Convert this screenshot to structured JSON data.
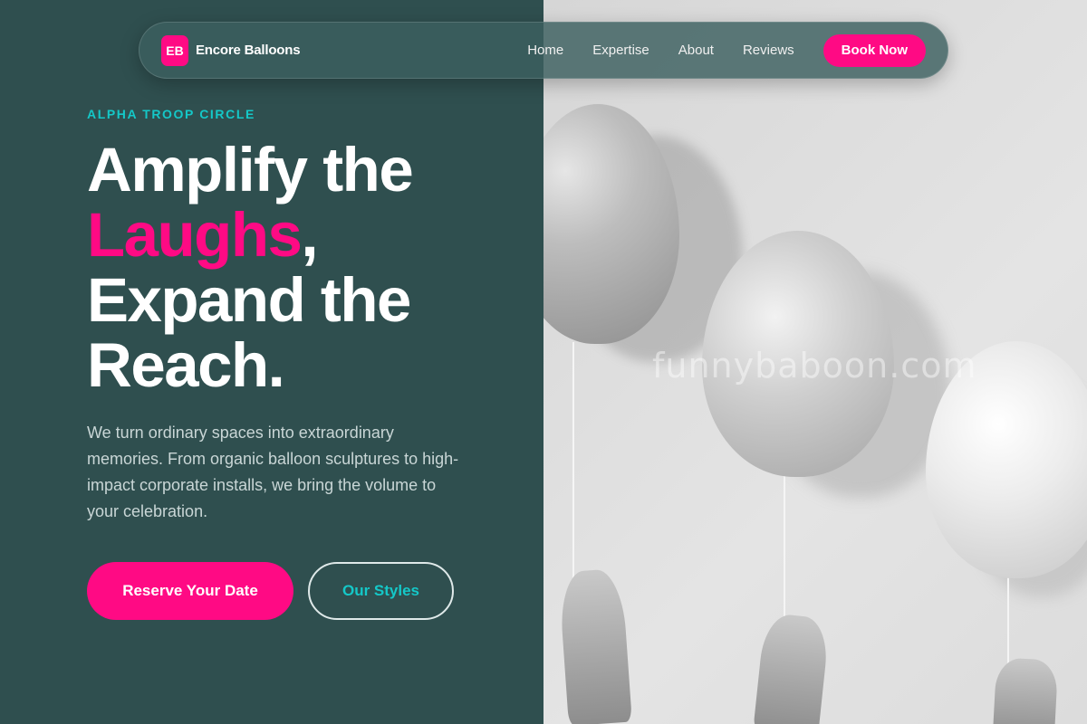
{
  "brand": {
    "badge": "EB",
    "name": "Encore Balloons",
    "accent_color": "#ff0a84",
    "teal_color": "#14c8c8",
    "panel_color": "#2f4f4f"
  },
  "nav": {
    "items": [
      {
        "label": "Home"
      },
      {
        "label": "Expertise"
      },
      {
        "label": "About"
      },
      {
        "label": "Reviews"
      }
    ],
    "cta_label": "Book Now"
  },
  "hero": {
    "eyebrow": "ALPHA TROOP CIRCLE",
    "headline_line1": "Amplify the",
    "headline_accent": "Laughs",
    "headline_comma": ",",
    "headline_line3": "Expand the",
    "headline_line4": "Reach.",
    "subcopy": "We turn ordinary spaces into extraordinary memories. From organic balloon sculptures to high-impact corporate installs, we bring the volume to your celebration.",
    "primary_cta": "Reserve Your Date",
    "secondary_cta": "Our Styles"
  },
  "image": {
    "watermark": "funnybaboon.com",
    "subject": "three balloons held by hands"
  }
}
